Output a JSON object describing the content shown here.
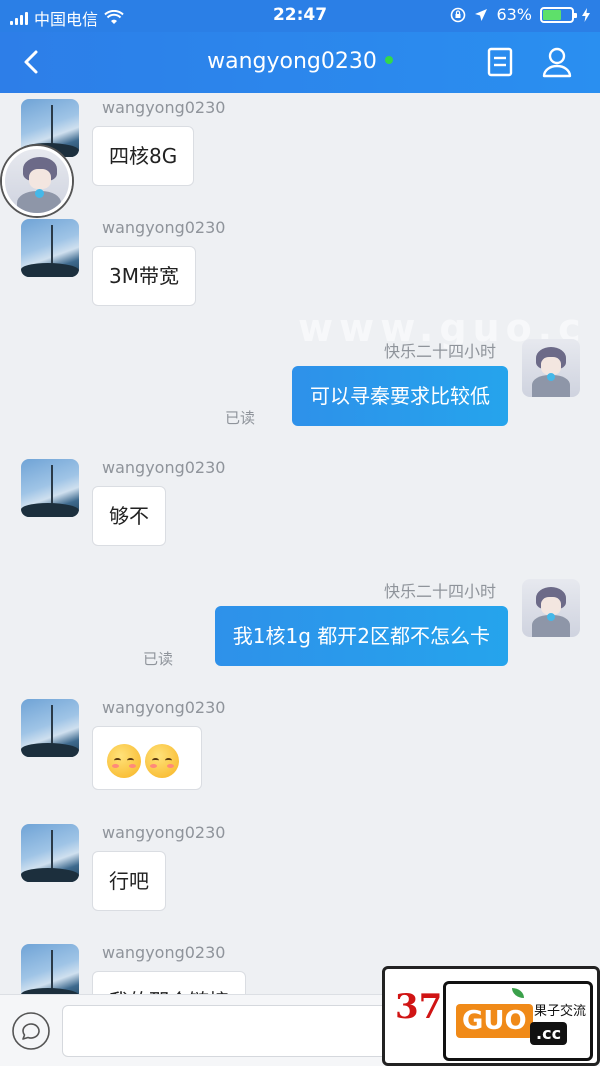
{
  "status_bar": {
    "carrier": "中国电信",
    "time": "22:47",
    "battery_percent": "63%",
    "battery_level": 0.63
  },
  "header": {
    "title": "wangyong0230",
    "online_color": "#33d84a"
  },
  "messages": [
    {
      "sender": "wangyong0230",
      "text": "四核8G"
    },
    {
      "sender": "wangyong0230",
      "text": "3M带宽"
    },
    {
      "sender": "快乐二十四小时",
      "text": "可以寻秦要求比较低",
      "status": "已读"
    },
    {
      "sender": "wangyong0230",
      "text": "够不"
    },
    {
      "sender": "快乐二十四小时",
      "text": "我1核1g 都开2区都不怎么卡",
      "status": "已读"
    },
    {
      "sender": "wangyong0230",
      "text": ""
    },
    {
      "sender": "wangyong0230",
      "text": "行吧"
    },
    {
      "sender": "wangyong0230",
      "text": "我的那个链接"
    }
  ],
  "watermark": "www.guo.c",
  "input": {
    "value": ""
  },
  "logo": {
    "number": "37",
    "brand": "GUO",
    "suffix": ".cc",
    "tagline": "果子交流"
  },
  "colors": {
    "header": "#2b7fe6",
    "bubble_out": "#2e91ea",
    "background": "#eef0f3"
  }
}
